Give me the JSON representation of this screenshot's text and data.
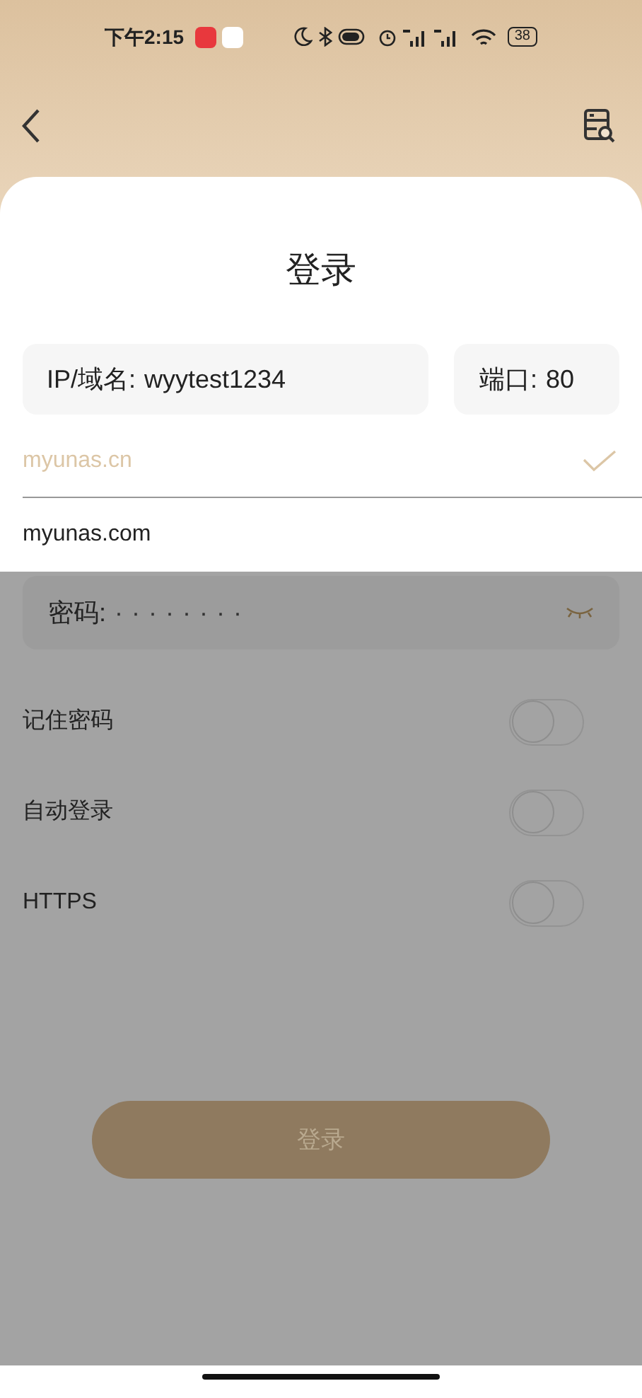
{
  "status_bar": {
    "time": "下午2:15",
    "battery": "38"
  },
  "title": "登录",
  "host_field": {
    "label": "IP/域名:",
    "value": "wyytest1234"
  },
  "port_field": {
    "label": "端口:",
    "value": "80"
  },
  "domain_suggestions": [
    {
      "text": "myunas.cn",
      "selected": true
    },
    {
      "text": "myunas.com",
      "selected": false
    }
  ],
  "password_field": {
    "label": "密码:",
    "value": "········"
  },
  "options": [
    {
      "label": "记住密码",
      "on": false
    },
    {
      "label": "自动登录",
      "on": false
    },
    {
      "label": "HTTPS",
      "on": false
    }
  ],
  "login_button": {
    "label": "登录"
  }
}
